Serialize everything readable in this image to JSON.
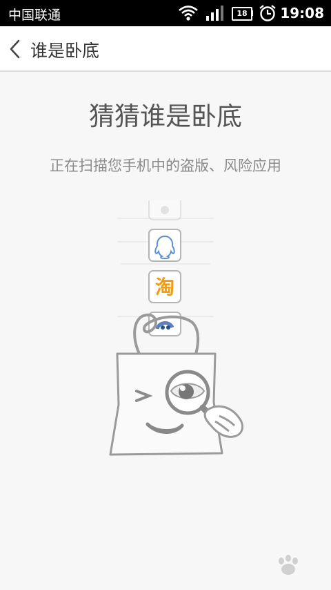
{
  "statusbar": {
    "carrier": "中国联通",
    "battery_level": "18",
    "time": "19:08",
    "icons": [
      "wifi-icon",
      "signal-icon",
      "battery-icon",
      "alarm-icon"
    ]
  },
  "appbar": {
    "title": "谁是卧底",
    "back_icon": "chevron-left-icon"
  },
  "main": {
    "headline": "猜猜谁是卧底",
    "subtext": "正在扫描您手机中的盗版、风险应用",
    "scanning_app_icons": [
      "qq-icon",
      "taobao-icon",
      "weibo-icon"
    ],
    "taobao_glyph": "淘"
  },
  "colors": {
    "statusbar_bg": "#000000",
    "appbar_bg": "#ffffff",
    "page_bg": "#f7f7f7",
    "illustration_gray": "#9a9a9a",
    "qq_blue": "#5b8fd6",
    "taobao_orange": "#f39c12"
  }
}
